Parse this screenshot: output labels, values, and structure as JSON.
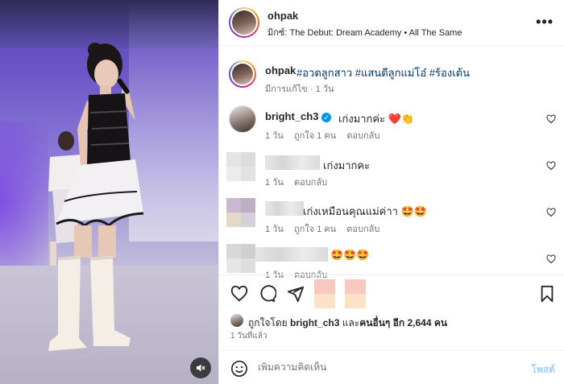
{
  "post": {
    "username": "ohpak",
    "audio": "มิกซ์: The Debut: Dream Academy • All The Same",
    "more_label": "•••",
    "caption_username": "ohpak",
    "caption_text": "#อวดลูกสาว #แสนดีลูกแม่โอ๋ #ร้องเต้น",
    "caption_meta": "มีการแก้ไข · 1 วัน"
  },
  "comments": [
    {
      "username": "bright_ch3",
      "verified": true,
      "text": "เก่งมากค่ะ ❤️👏",
      "time": "1 วัน",
      "likes": "ถูกใจ 1 คน",
      "reply": "ตอบกลับ"
    },
    {
      "username": "",
      "text": "เก่งมากคะ",
      "time": "1 วัน",
      "reply": "ตอบกลับ"
    },
    {
      "username": "",
      "text": "เก่งเหมือนคุณแม่ค่าา 🤩🤩",
      "time": "1 วัน",
      "likes": "ถูกใจ 1 คน",
      "reply": "ตอบกลับ"
    },
    {
      "username": "",
      "text": "🤩🤩🤩",
      "time": "1 วัน",
      "reply": "ตอบกลับ"
    }
  ],
  "likes": {
    "prefix": "ถูกใจโดย ",
    "user": "bright_ch3",
    "middle": " และ",
    "others": "คนอื่นๆ อีก 2,644 คน"
  },
  "post_time": "1 วันที่แล้ว",
  "comment_box": {
    "placeholder": "เพิ่มความคิดเห็น",
    "post_label": "โพสต์"
  },
  "colors": {
    "link": "#00376b",
    "verified": "#0095f6",
    "muted": "#737373",
    "post_disabled": "#a3cffa"
  }
}
